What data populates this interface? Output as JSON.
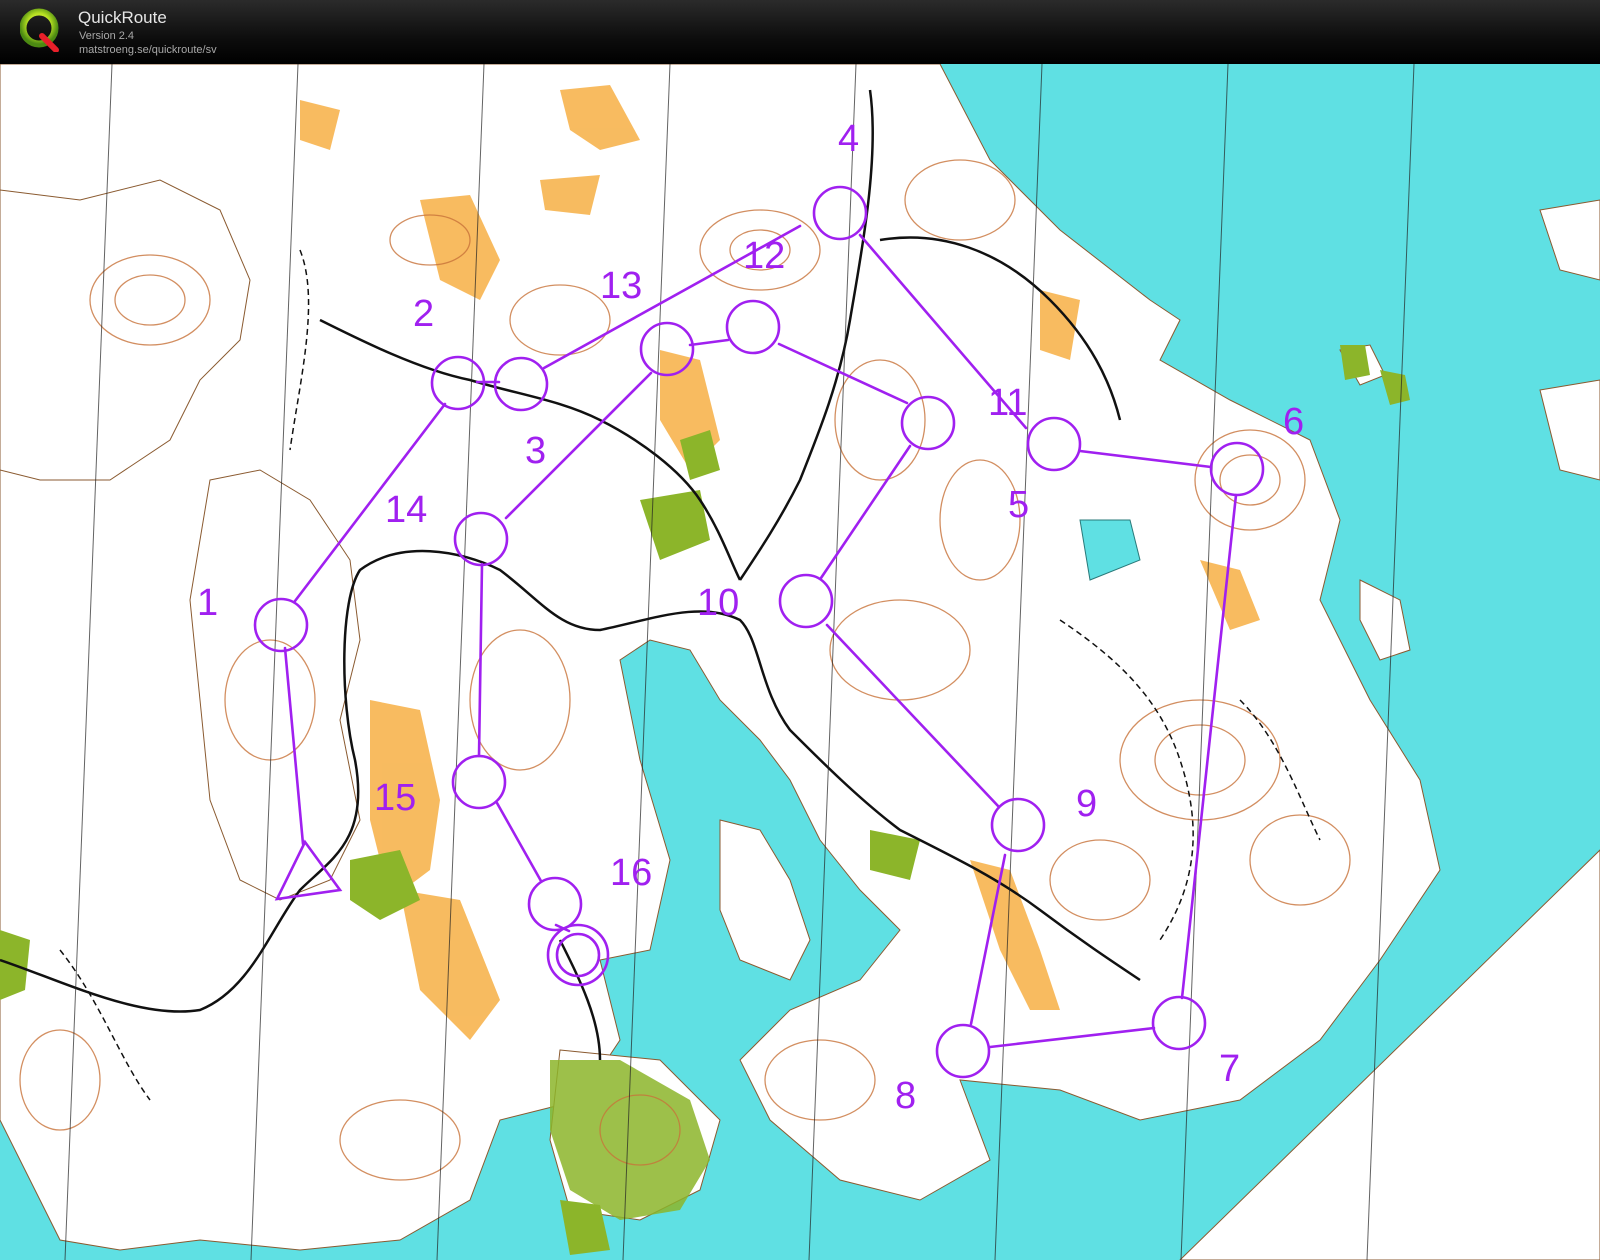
{
  "header": {
    "app_name": "QuickRoute",
    "version": "Version 2.4",
    "url": "matstroeng.se/quickroute/sv"
  },
  "colors": {
    "water": "#5fe0e3",
    "land": "#ffffff",
    "contour": "#c8733a",
    "yellow": "#f7b44f",
    "green": "#8cb52a",
    "course": "#a020f0",
    "path": "#111111"
  },
  "course": {
    "controls": [
      {
        "number": "1"
      },
      {
        "number": "2"
      },
      {
        "number": "3"
      },
      {
        "number": "4"
      },
      {
        "number": "5"
      },
      {
        "number": "6"
      },
      {
        "number": "7"
      },
      {
        "number": "8"
      },
      {
        "number": "9"
      },
      {
        "number": "10"
      },
      {
        "number": "11"
      },
      {
        "number": "12"
      },
      {
        "number": "13"
      },
      {
        "number": "14"
      },
      {
        "number": "15"
      },
      {
        "number": "16"
      }
    ]
  }
}
